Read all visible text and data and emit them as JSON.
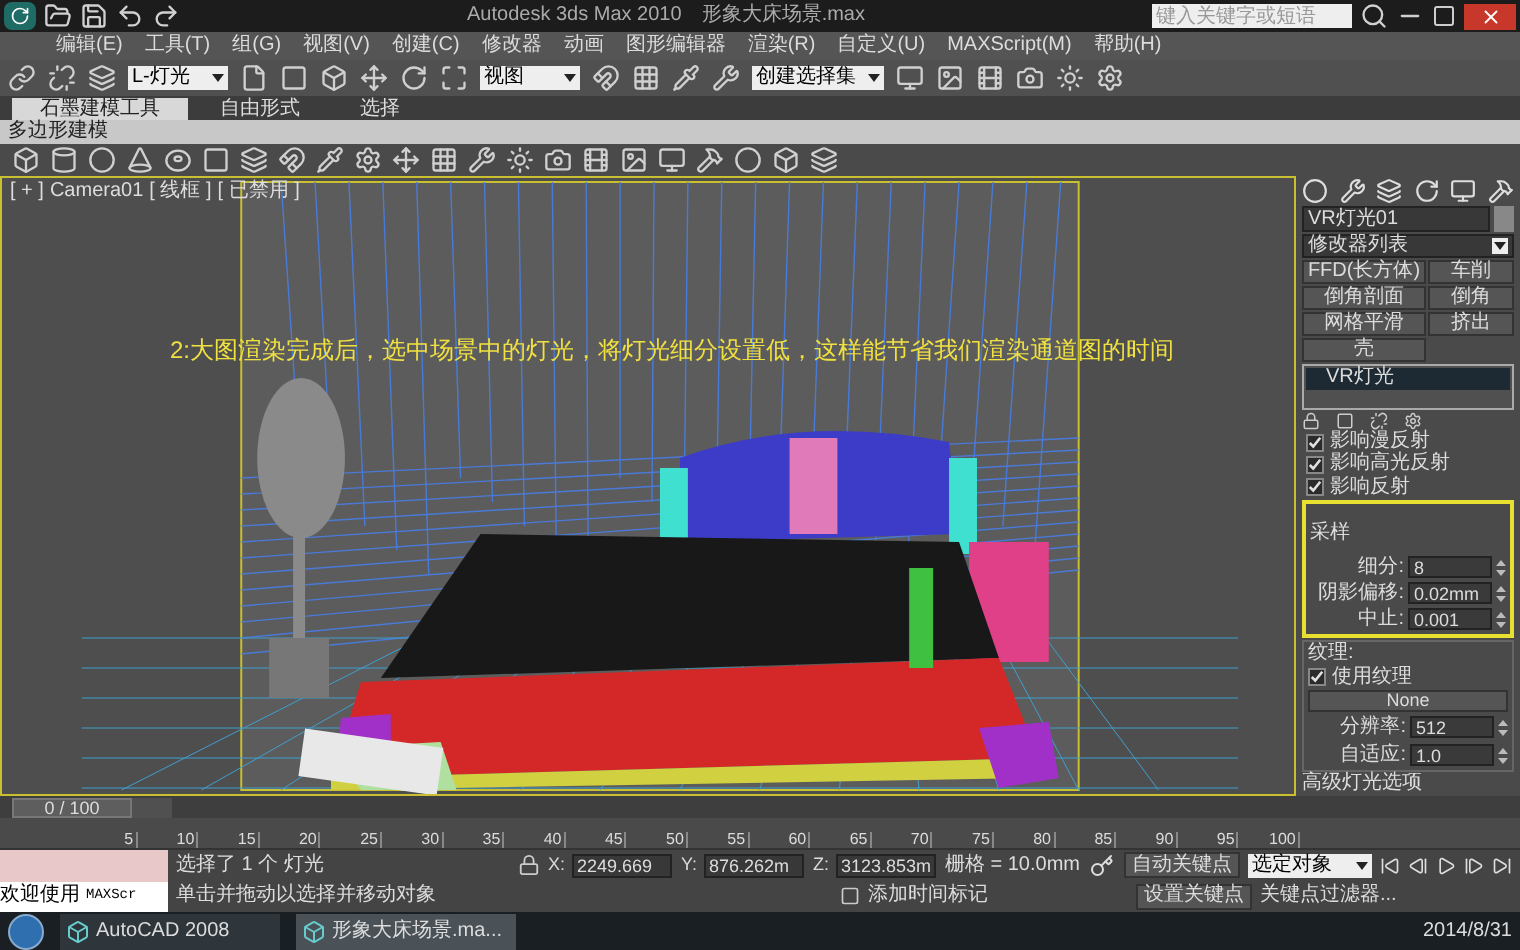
{
  "title_bar": {
    "title": "Autodesk 3ds Max 2010",
    "file": "形象大床场景.max",
    "search": {
      "placeholder": "键入关键字或短语"
    }
  },
  "menu": [
    "编辑(E)",
    "工具(T)",
    "组(G)",
    "视图(V)",
    "创建(C)",
    "修改器",
    "动画",
    "图形编辑器",
    "渲染(R)",
    "自定义(U)",
    "MAXScript(M)",
    "帮助(H)"
  ],
  "toolbar": {
    "selection_filter": "L-灯光",
    "coordinate_system": "视图",
    "selection_set": "创建选择集"
  },
  "ribbon_tabs": [
    {
      "label": "石墨建模工具",
      "selected": true
    },
    {
      "label": "自由形式",
      "selected": false
    },
    {
      "label": "选择",
      "selected": false
    }
  ],
  "ribbon_panel": "多边形建模",
  "viewport": {
    "labels": [
      "[ + ]",
      "Camera01",
      "[ 线框 ]",
      "[ 已禁用 ]"
    ],
    "caption": "2:大图渲染完成后，选中场景中的灯光，将灯光细分设置低，这样能节省我们渲染通道图的时间"
  },
  "command_panel": {
    "object_name": "VR灯光01",
    "modifier_list": "修改器列表",
    "modifier_buttons": [
      "FFD(长方体)",
      "车削",
      "倒角剖面",
      "倒角",
      "网格平滑",
      "挤出",
      "壳"
    ],
    "stack": [
      {
        "label": "VR灯光",
        "selected": true
      }
    ],
    "options": [
      {
        "label": "影响漫反射",
        "checked": true
      },
      {
        "label": "影响高光反射",
        "checked": true
      },
      {
        "label": "影响反射",
        "checked": true
      }
    ],
    "sampling": {
      "title": "采样",
      "highlighted": true,
      "fields": [
        {
          "label": "细分:",
          "value": "8"
        },
        {
          "label": "阴影偏移:",
          "value": "0.02mm"
        },
        {
          "label": "中止:",
          "value": "0.001"
        }
      ]
    },
    "texture": {
      "title": "纹理:",
      "use_texture": {
        "label": "使用纹理",
        "checked": true
      },
      "map_button": "None",
      "fields": [
        {
          "label": "分辨率:",
          "value": "512"
        },
        {
          "label": "自适应:",
          "value": "1.0"
        }
      ]
    },
    "next_rollout": "高级灯光选项"
  },
  "timeline": {
    "frame": "0 / 100",
    "level": 0,
    "ticks": [
      "5",
      "10",
      "15",
      "20",
      "25",
      "30",
      "35",
      "40",
      "45",
      "50",
      "55",
      "60",
      "65",
      "70",
      "75",
      "80",
      "85",
      "90",
      "95",
      "100"
    ]
  },
  "status": {
    "script_label": "欢迎使用",
    "script_field": "MAXScr",
    "selection": "选择了 1 个 灯光",
    "prompt": "单击并拖动以选择并移动对象",
    "coords": [
      {
        "axis": "X:",
        "value": "2249.669"
      },
      {
        "axis": "Y:",
        "value": "876.262m"
      },
      {
        "axis": "Z:",
        "value": "3123.853m"
      }
    ],
    "grid": "栅格 = 10.0mm",
    "add_time_tag": "添加时间标记",
    "auto_key": "自动关键点",
    "set_key": "设置关键点",
    "key_target": "选定对象",
    "key_filters": "关键点过滤器..."
  },
  "taskbar": {
    "apps": [
      {
        "label": "AutoCAD 2008",
        "selected": false
      },
      {
        "label": "形象大床场景.ma...",
        "selected": true
      }
    ],
    "date": "2014/8/31"
  }
}
